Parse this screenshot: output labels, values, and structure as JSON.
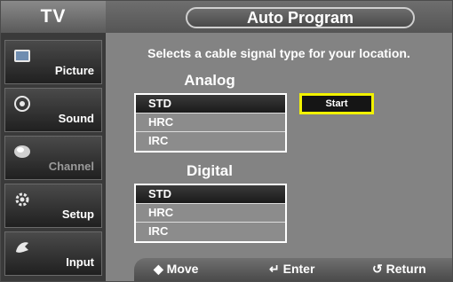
{
  "header": {
    "tv_label": "TV",
    "title": "Auto Program"
  },
  "sidebar": {
    "items": [
      {
        "label": "Picture",
        "icon": "picture-icon"
      },
      {
        "label": "Sound",
        "icon": "sound-icon"
      },
      {
        "label": "Channel",
        "icon": "channel-icon"
      },
      {
        "label": "Setup",
        "icon": "setup-icon"
      },
      {
        "label": "Input",
        "icon": "input-icon"
      }
    ],
    "active": "Channel"
  },
  "main": {
    "description": "Selects a cable signal type for your location.",
    "analog": {
      "title": "Analog",
      "options": [
        "STD",
        "HRC",
        "IRC"
      ],
      "selected": "STD"
    },
    "digital": {
      "title": "Digital",
      "options": [
        "STD",
        "HRC",
        "IRC"
      ],
      "selected": "STD"
    },
    "start_label": "Start"
  },
  "footer": {
    "move": "◆ Move",
    "enter": "↵ Enter",
    "return": "↺ Return"
  },
  "colors": {
    "background": "#838383",
    "highlight": "#f2f200",
    "selected_row": "#1a1a1a"
  }
}
